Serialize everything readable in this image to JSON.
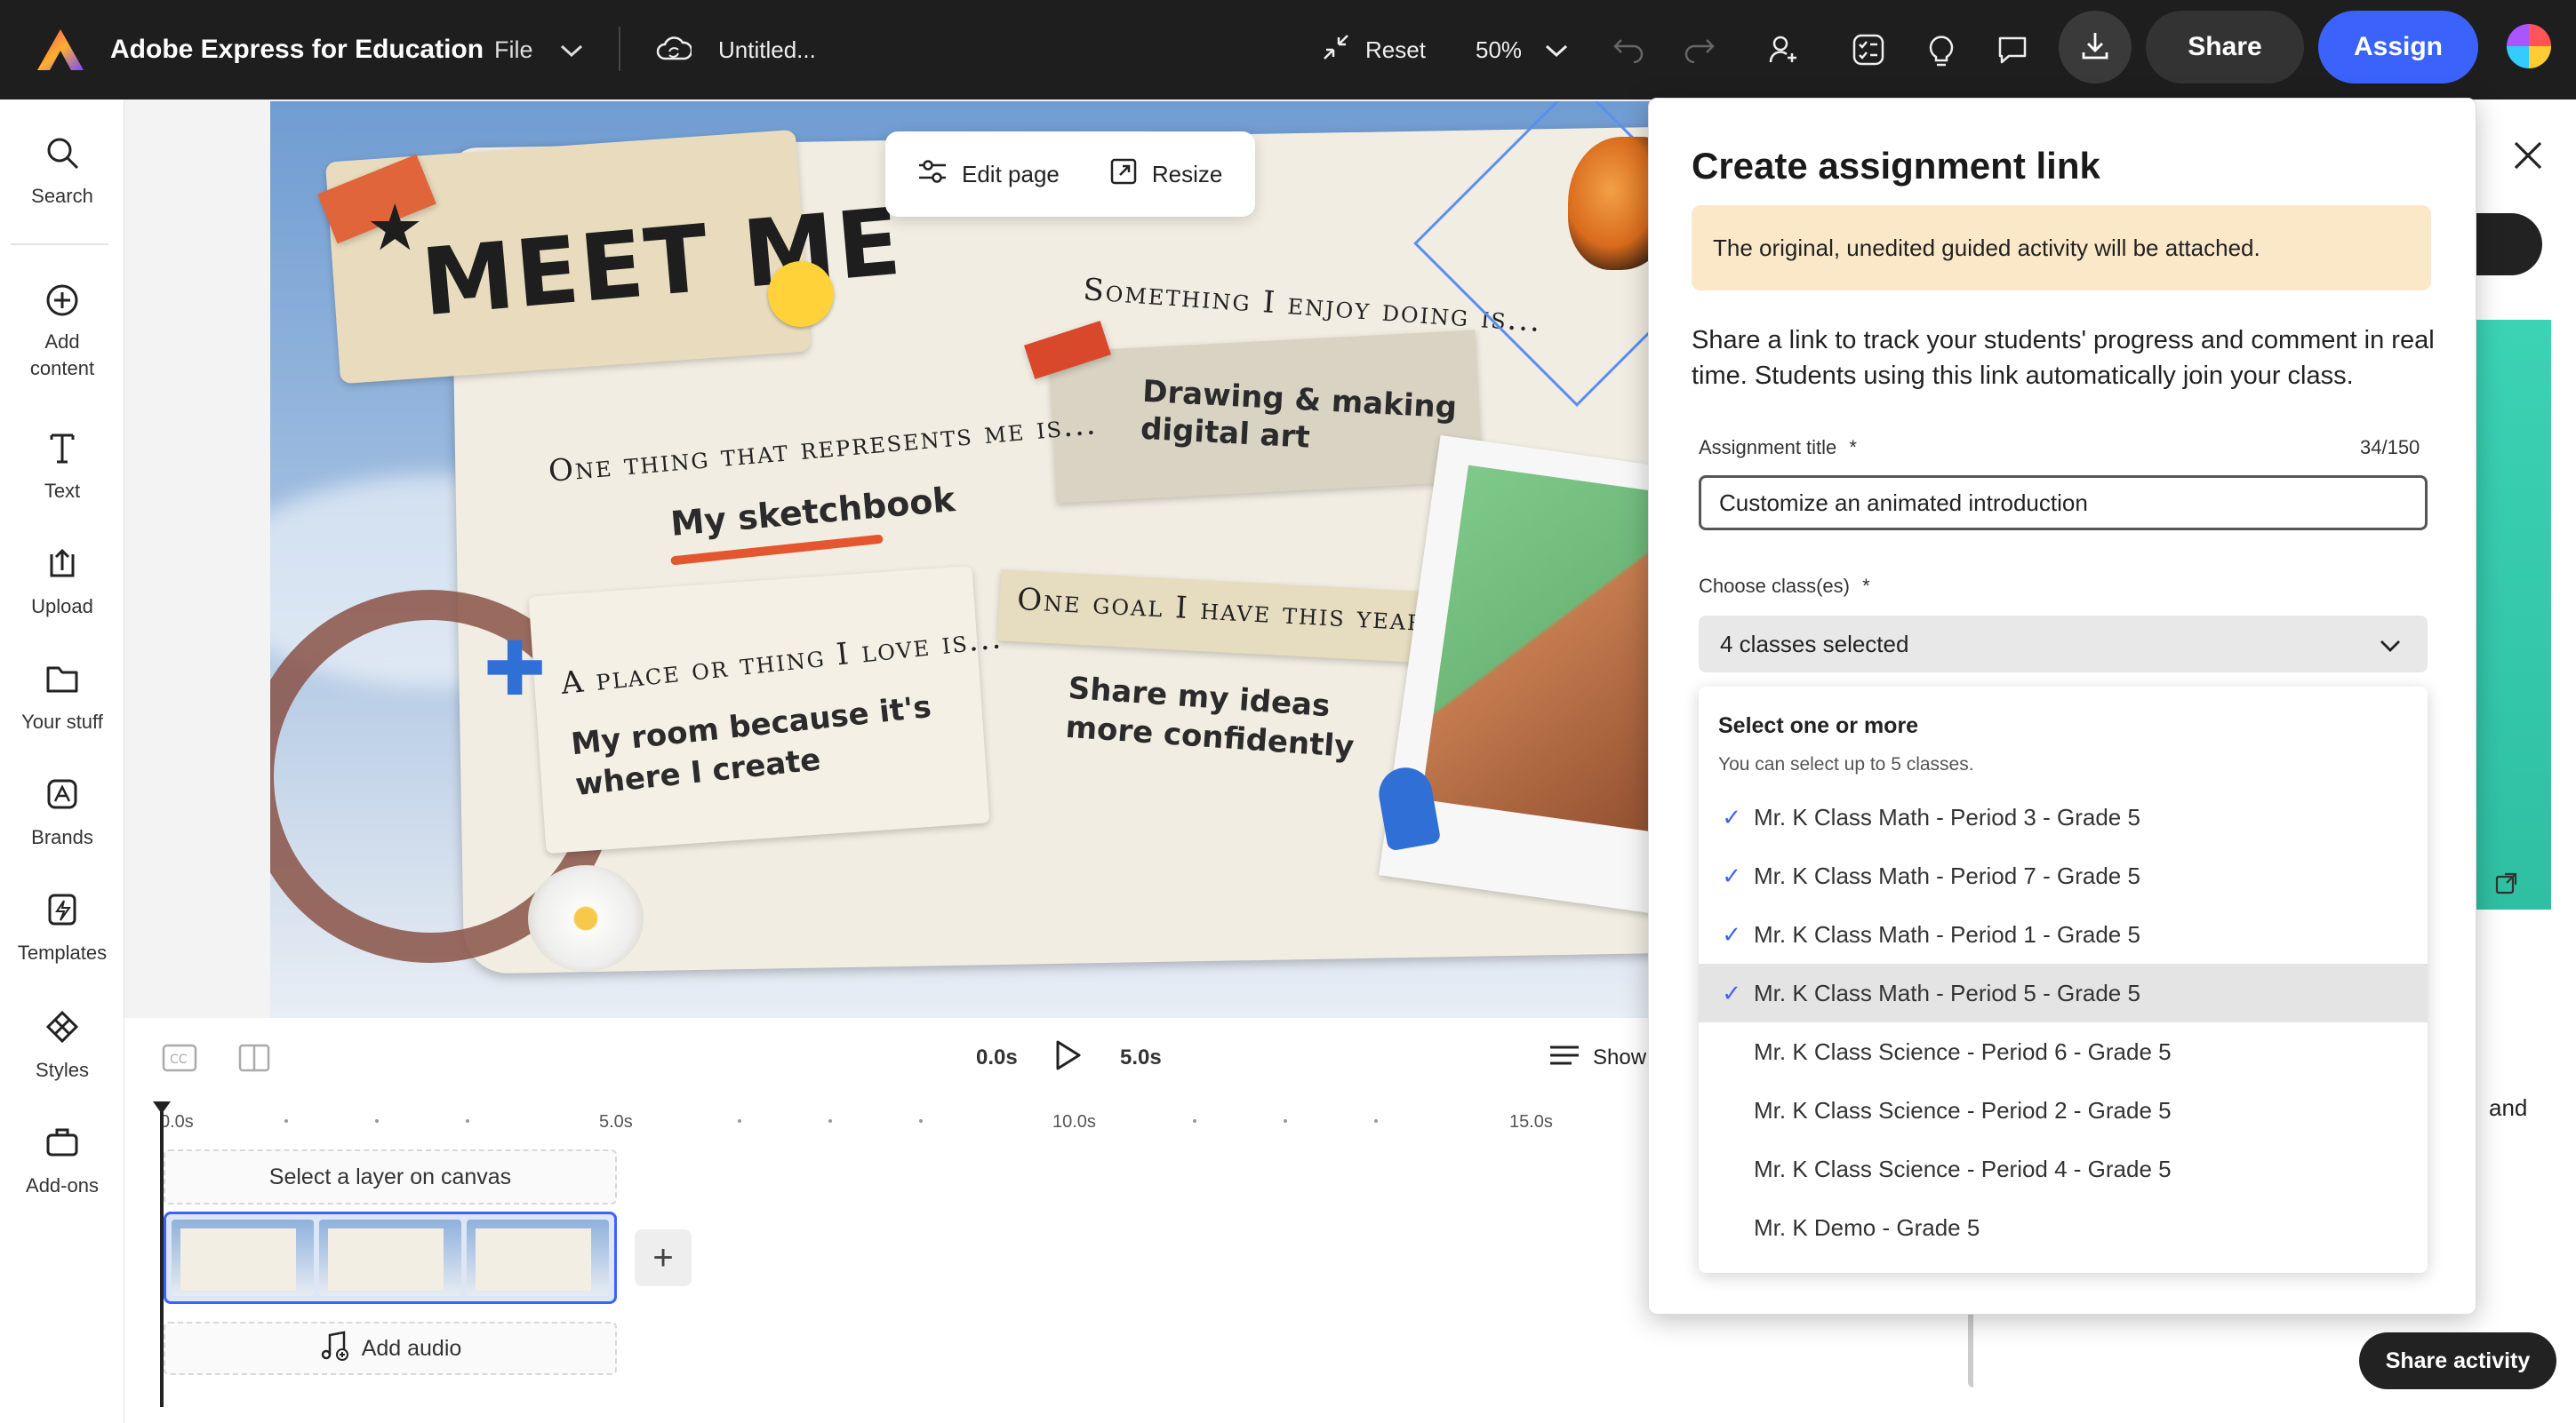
{
  "topbar": {
    "app_title": "Adobe Express for Education",
    "file_label": "File",
    "doc_title": "Untitled...",
    "reset_label": "Reset",
    "zoom_label": "50%",
    "share_label": "Share",
    "assign_label": "Assign"
  },
  "rail": {
    "items": [
      {
        "label": "Search",
        "icon": "search-icon"
      },
      {
        "label": "Add\ncontent",
        "icon": "add-icon"
      },
      {
        "label": "Text",
        "icon": "text-icon"
      },
      {
        "label": "Upload",
        "icon": "upload-icon"
      },
      {
        "label": "Your stuff",
        "icon": "folder-icon"
      },
      {
        "label": "Brands",
        "icon": "brand-icon"
      },
      {
        "label": "Templates",
        "icon": "templates-icon"
      },
      {
        "label": "Styles",
        "icon": "styles-icon"
      },
      {
        "label": "Add-ons",
        "icon": "addons-icon"
      }
    ]
  },
  "page_tools": {
    "edit_page": "Edit page",
    "resize": "Resize"
  },
  "canvas": {
    "meet_me": "MEET ME",
    "something_enjoy": "Something I enjoy doing is...",
    "drawing_art": "Drawing & making\ndigital art",
    "one_thing": "One thing that represents me is...",
    "sketchbook": "My sketchbook",
    "place_love": "A place or thing I love is...",
    "my_room": "My room because it's\nwhere I create",
    "one_goal": "One goal I have this year is...",
    "share_ideas": "Share my ideas\nmore confidently"
  },
  "timeline": {
    "start_time": "0.0s",
    "end_time": "5.0s",
    "show_label": "Show",
    "ticks": [
      "0.0s",
      "5.0s",
      "10.0s",
      "15.0s"
    ],
    "select_layer": "Select a layer on canvas",
    "add_audio": "Add audio"
  },
  "modal": {
    "title": "Create assignment link",
    "note": "The original, unedited guided activity will be attached.",
    "description": "Share a link to track your students' progress and comment in real time. Students using this link automatically join your class.",
    "assignment_title_label": "Assignment title",
    "required_mark": "*",
    "counter": "34/150",
    "assignment_title_value": "Customize an animated introduction",
    "choose_classes_label": "Choose class(es)",
    "classes_selected": "4 classes selected",
    "dropdown": {
      "heading": "Select one or more",
      "subheading": "You can select up to 5 classes.",
      "options": [
        {
          "label": "Mr. K Class Math - Period 3 - Grade 5",
          "checked": true
        },
        {
          "label": "Mr. K Class Math - Period 7 - Grade 5",
          "checked": true
        },
        {
          "label": "Mr. K Class Math - Period 1 - Grade 5",
          "checked": true
        },
        {
          "label": "Mr. K Class Math - Period 5 - Grade 5",
          "checked": true
        },
        {
          "label": "Mr. K Class Science - Period 6 - Grade 5",
          "checked": false
        },
        {
          "label": "Mr. K Class Science - Period 2 - Grade 5",
          "checked": false
        },
        {
          "label": "Mr. K Class Science - Period 4 - Grade 5",
          "checked": false
        },
        {
          "label": "Mr. K Demo - Grade 5",
          "checked": false
        }
      ]
    }
  },
  "right_panel": {
    "partial_text": "and",
    "share_activity": "Share activity"
  },
  "colors": {
    "accent": "#3b63fb",
    "topbar_bg": "#1e1e1e",
    "note_bg": "#fbe8c8"
  }
}
